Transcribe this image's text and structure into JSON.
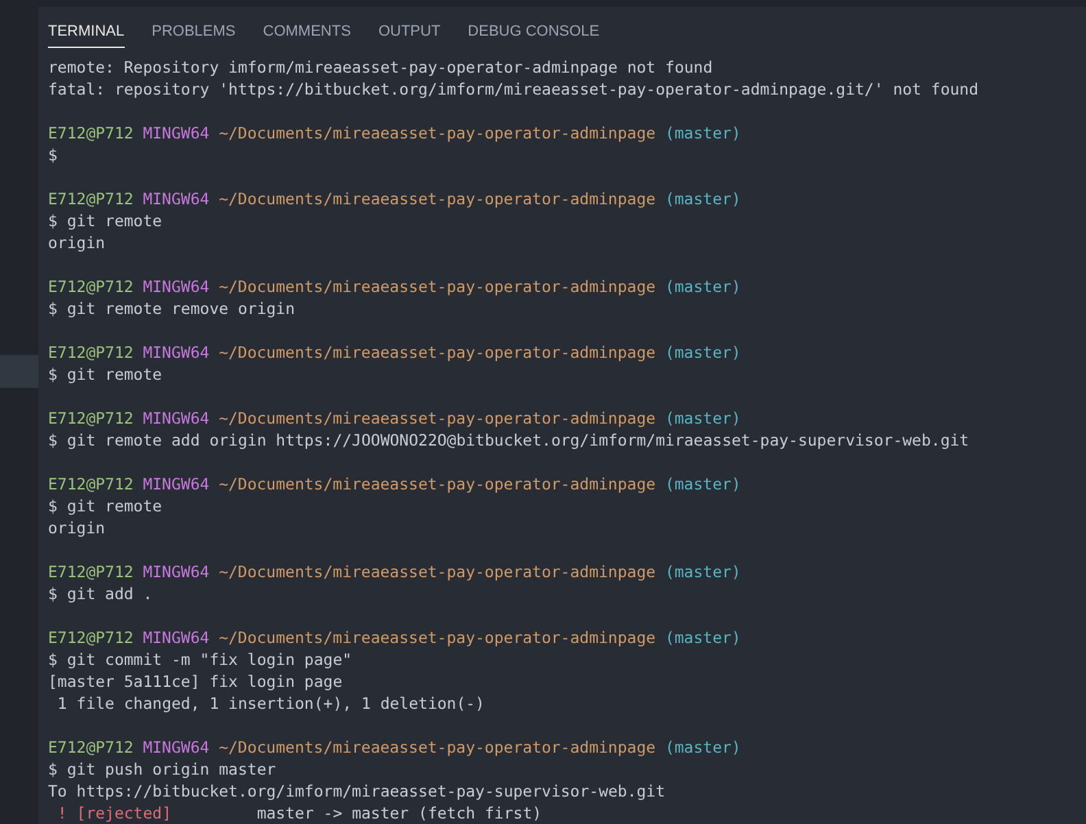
{
  "tabs": [
    {
      "label": "TERMINAL",
      "selected": true
    },
    {
      "label": "PROBLEMS",
      "selected": false
    },
    {
      "label": "COMMENTS",
      "selected": false
    },
    {
      "label": "OUTPUT",
      "selected": false
    },
    {
      "label": "DEBUG CONSOLE",
      "selected": false
    }
  ],
  "terminal_lines": [
    {
      "kind": "output",
      "text": "remote: Repository imform/mireaeasset-pay-operator-adminpage not found"
    },
    {
      "kind": "output",
      "text": "fatal: repository 'https://bitbucket.org/imform/mireaeasset-pay-operator-adminpage.git/' not found"
    },
    {
      "kind": "blank"
    },
    {
      "kind": "prompt",
      "user": "E712@P712",
      "system": "MINGW64",
      "path": "~/Documents/mireaeasset-pay-operator-adminpage",
      "branch": "(master)"
    },
    {
      "kind": "output",
      "text": "$"
    },
    {
      "kind": "blank"
    },
    {
      "kind": "prompt",
      "user": "E712@P712",
      "system": "MINGW64",
      "path": "~/Documents/mireaeasset-pay-operator-adminpage",
      "branch": "(master)"
    },
    {
      "kind": "output",
      "text": "$ git remote"
    },
    {
      "kind": "output",
      "text": "origin"
    },
    {
      "kind": "blank"
    },
    {
      "kind": "prompt",
      "user": "E712@P712",
      "system": "MINGW64",
      "path": "~/Documents/mireaeasset-pay-operator-adminpage",
      "branch": "(master)"
    },
    {
      "kind": "output",
      "text": "$ git remote remove origin"
    },
    {
      "kind": "blank"
    },
    {
      "kind": "prompt",
      "user": "E712@P712",
      "system": "MINGW64",
      "path": "~/Documents/mireaeasset-pay-operator-adminpage",
      "branch": "(master)"
    },
    {
      "kind": "output",
      "text": "$ git remote"
    },
    {
      "kind": "blank"
    },
    {
      "kind": "prompt",
      "user": "E712@P712",
      "system": "MINGW64",
      "path": "~/Documents/mireaeasset-pay-operator-adminpage",
      "branch": "(master)"
    },
    {
      "kind": "output",
      "text": "$ git remote add origin https://JOOWONO22O@bitbucket.org/imform/miraeasset-pay-supervisor-web.git"
    },
    {
      "kind": "blank"
    },
    {
      "kind": "prompt",
      "user": "E712@P712",
      "system": "MINGW64",
      "path": "~/Documents/mireaeasset-pay-operator-adminpage",
      "branch": "(master)"
    },
    {
      "kind": "output",
      "text": "$ git remote"
    },
    {
      "kind": "output",
      "text": "origin"
    },
    {
      "kind": "blank"
    },
    {
      "kind": "prompt",
      "user": "E712@P712",
      "system": "MINGW64",
      "path": "~/Documents/mireaeasset-pay-operator-adminpage",
      "branch": "(master)"
    },
    {
      "kind": "output",
      "text": "$ git add ."
    },
    {
      "kind": "blank"
    },
    {
      "kind": "prompt",
      "user": "E712@P712",
      "system": "MINGW64",
      "path": "~/Documents/mireaeasset-pay-operator-adminpage",
      "branch": "(master)"
    },
    {
      "kind": "output",
      "text": "$ git commit -m \"fix login page\""
    },
    {
      "kind": "output",
      "text": "[master 5a111ce] fix login page"
    },
    {
      "kind": "output",
      "text": " 1 file changed, 1 insertion(+), 1 deletion(-)"
    },
    {
      "kind": "blank"
    },
    {
      "kind": "prompt",
      "user": "E712@P712",
      "system": "MINGW64",
      "path": "~/Documents/mireaeasset-pay-operator-adminpage",
      "branch": "(master)"
    },
    {
      "kind": "output",
      "text": "$ git push origin master"
    },
    {
      "kind": "output",
      "text": "To https://bitbucket.org/imform/miraeasset-pay-supervisor-web.git"
    },
    {
      "kind": "error",
      "status": "! [rejected]",
      "text": "master -> master (fetch first)"
    }
  ]
}
